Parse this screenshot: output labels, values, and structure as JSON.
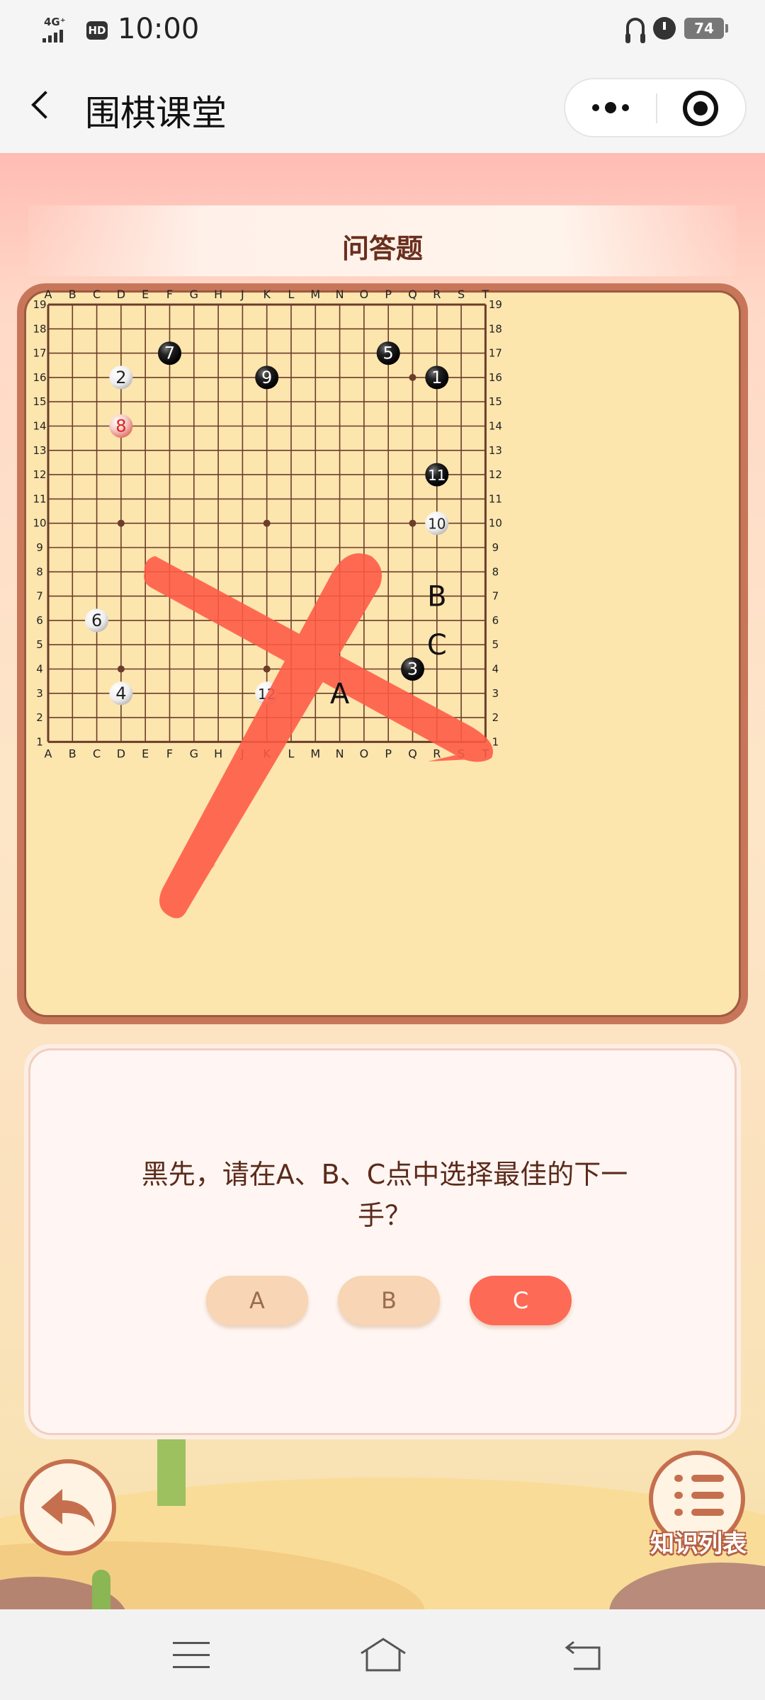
{
  "status_bar": {
    "network": "4G⁺",
    "hd": "HD",
    "time": "10:00",
    "battery": "74",
    "icons": [
      "signal-icon",
      "hd-icon",
      "headset-icon",
      "alarm-icon",
      "battery-icon"
    ]
  },
  "nav": {
    "title": "围棋课堂",
    "icons": [
      "back-chevron-icon",
      "more-dots-icon",
      "close-target-icon"
    ]
  },
  "section_title": "问答题",
  "board": {
    "columns": [
      "A",
      "B",
      "C",
      "D",
      "E",
      "F",
      "G",
      "H",
      "J",
      "K",
      "L",
      "M",
      "N",
      "O",
      "P",
      "Q",
      "R",
      "S",
      "T"
    ],
    "rows": [
      "19",
      "18",
      "17",
      "16",
      "15",
      "14",
      "13",
      "12",
      "11",
      "10",
      "9",
      "8",
      "7",
      "6",
      "5",
      "4",
      "3",
      "2",
      "1"
    ],
    "star_points": [
      "D16",
      "K16",
      "Q16",
      "D10",
      "K10",
      "Q10",
      "D4",
      "K4",
      "Q4"
    ],
    "stones": [
      {
        "num": "1",
        "color": "black",
        "pos": "R16"
      },
      {
        "num": "2",
        "color": "white",
        "pos": "D16"
      },
      {
        "num": "3",
        "color": "black",
        "pos": "Q4"
      },
      {
        "num": "4",
        "color": "white",
        "pos": "D3"
      },
      {
        "num": "5",
        "color": "black",
        "pos": "P17"
      },
      {
        "num": "6",
        "color": "white",
        "pos": "C6"
      },
      {
        "num": "7",
        "color": "black",
        "pos": "F17"
      },
      {
        "num": "8",
        "color": "red",
        "pos": "D14"
      },
      {
        "num": "9",
        "color": "black",
        "pos": "K16"
      },
      {
        "num": "10",
        "color": "white",
        "pos": "R10"
      },
      {
        "num": "11",
        "color": "black",
        "pos": "R12"
      },
      {
        "num": "12",
        "color": "white",
        "pos": "K3"
      }
    ],
    "marks": [
      {
        "label": "A",
        "pos": "N3"
      },
      {
        "label": "B",
        "pos": "R7"
      },
      {
        "label": "C",
        "pos": "R5"
      }
    ],
    "wrong_mark_color": "#ff5a45"
  },
  "question": {
    "text": "黑先，请在A、B、C点中选择最佳的下一手？",
    "options": [
      "A",
      "B",
      "C"
    ],
    "selected": "C"
  },
  "bottom": {
    "list_label": "知识列表",
    "icons": [
      "undo-arrow-icon",
      "list-icon"
    ]
  },
  "system_nav": {
    "icons": [
      "menu-icon",
      "home-icon",
      "back-icon"
    ]
  },
  "colors": {
    "accent": "#fd6a55",
    "board": "#fde5ae",
    "board_frame": "#c8765a",
    "option_inactive": "#f7d5b5",
    "title_text": "#6a2f1e"
  }
}
